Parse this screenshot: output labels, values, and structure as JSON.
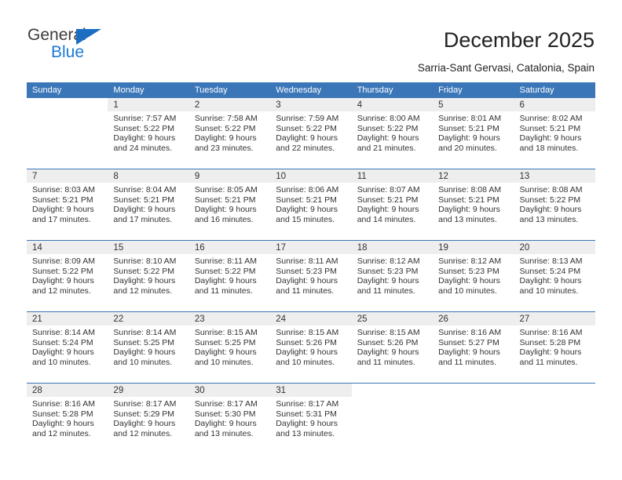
{
  "brand": {
    "name_top": "General",
    "name_bottom": "Blue",
    "triangle_color": "#1b6ec2",
    "blue_color": "#1b7ad6"
  },
  "header": {
    "title": "December 2025",
    "subtitle": "Sarria-Sant Gervasi, Catalonia, Spain",
    "accent_color": "#3a76b8"
  },
  "calendar": {
    "weekday_headers": [
      "Sunday",
      "Monday",
      "Tuesday",
      "Wednesday",
      "Thursday",
      "Friday",
      "Saturday"
    ],
    "weeks": [
      [
        {
          "day": "",
          "sunrise": "",
          "sunset": "",
          "daylight1": "",
          "daylight2": ""
        },
        {
          "day": "1",
          "sunrise": "Sunrise: 7:57 AM",
          "sunset": "Sunset: 5:22 PM",
          "daylight1": "Daylight: 9 hours",
          "daylight2": "and 24 minutes."
        },
        {
          "day": "2",
          "sunrise": "Sunrise: 7:58 AM",
          "sunset": "Sunset: 5:22 PM",
          "daylight1": "Daylight: 9 hours",
          "daylight2": "and 23 minutes."
        },
        {
          "day": "3",
          "sunrise": "Sunrise: 7:59 AM",
          "sunset": "Sunset: 5:22 PM",
          "daylight1": "Daylight: 9 hours",
          "daylight2": "and 22 minutes."
        },
        {
          "day": "4",
          "sunrise": "Sunrise: 8:00 AM",
          "sunset": "Sunset: 5:22 PM",
          "daylight1": "Daylight: 9 hours",
          "daylight2": "and 21 minutes."
        },
        {
          "day": "5",
          "sunrise": "Sunrise: 8:01 AM",
          "sunset": "Sunset: 5:21 PM",
          "daylight1": "Daylight: 9 hours",
          "daylight2": "and 20 minutes."
        },
        {
          "day": "6",
          "sunrise": "Sunrise: 8:02 AM",
          "sunset": "Sunset: 5:21 PM",
          "daylight1": "Daylight: 9 hours",
          "daylight2": "and 18 minutes."
        }
      ],
      [
        {
          "day": "7",
          "sunrise": "Sunrise: 8:03 AM",
          "sunset": "Sunset: 5:21 PM",
          "daylight1": "Daylight: 9 hours",
          "daylight2": "and 17 minutes."
        },
        {
          "day": "8",
          "sunrise": "Sunrise: 8:04 AM",
          "sunset": "Sunset: 5:21 PM",
          "daylight1": "Daylight: 9 hours",
          "daylight2": "and 17 minutes."
        },
        {
          "day": "9",
          "sunrise": "Sunrise: 8:05 AM",
          "sunset": "Sunset: 5:21 PM",
          "daylight1": "Daylight: 9 hours",
          "daylight2": "and 16 minutes."
        },
        {
          "day": "10",
          "sunrise": "Sunrise: 8:06 AM",
          "sunset": "Sunset: 5:21 PM",
          "daylight1": "Daylight: 9 hours",
          "daylight2": "and 15 minutes."
        },
        {
          "day": "11",
          "sunrise": "Sunrise: 8:07 AM",
          "sunset": "Sunset: 5:21 PM",
          "daylight1": "Daylight: 9 hours",
          "daylight2": "and 14 minutes."
        },
        {
          "day": "12",
          "sunrise": "Sunrise: 8:08 AM",
          "sunset": "Sunset: 5:21 PM",
          "daylight1": "Daylight: 9 hours",
          "daylight2": "and 13 minutes."
        },
        {
          "day": "13",
          "sunrise": "Sunrise: 8:08 AM",
          "sunset": "Sunset: 5:22 PM",
          "daylight1": "Daylight: 9 hours",
          "daylight2": "and 13 minutes."
        }
      ],
      [
        {
          "day": "14",
          "sunrise": "Sunrise: 8:09 AM",
          "sunset": "Sunset: 5:22 PM",
          "daylight1": "Daylight: 9 hours",
          "daylight2": "and 12 minutes."
        },
        {
          "day": "15",
          "sunrise": "Sunrise: 8:10 AM",
          "sunset": "Sunset: 5:22 PM",
          "daylight1": "Daylight: 9 hours",
          "daylight2": "and 12 minutes."
        },
        {
          "day": "16",
          "sunrise": "Sunrise: 8:11 AM",
          "sunset": "Sunset: 5:22 PM",
          "daylight1": "Daylight: 9 hours",
          "daylight2": "and 11 minutes."
        },
        {
          "day": "17",
          "sunrise": "Sunrise: 8:11 AM",
          "sunset": "Sunset: 5:23 PM",
          "daylight1": "Daylight: 9 hours",
          "daylight2": "and 11 minutes."
        },
        {
          "day": "18",
          "sunrise": "Sunrise: 8:12 AM",
          "sunset": "Sunset: 5:23 PM",
          "daylight1": "Daylight: 9 hours",
          "daylight2": "and 11 minutes."
        },
        {
          "day": "19",
          "sunrise": "Sunrise: 8:12 AM",
          "sunset": "Sunset: 5:23 PM",
          "daylight1": "Daylight: 9 hours",
          "daylight2": "and 10 minutes."
        },
        {
          "day": "20",
          "sunrise": "Sunrise: 8:13 AM",
          "sunset": "Sunset: 5:24 PM",
          "daylight1": "Daylight: 9 hours",
          "daylight2": "and 10 minutes."
        }
      ],
      [
        {
          "day": "21",
          "sunrise": "Sunrise: 8:14 AM",
          "sunset": "Sunset: 5:24 PM",
          "daylight1": "Daylight: 9 hours",
          "daylight2": "and 10 minutes."
        },
        {
          "day": "22",
          "sunrise": "Sunrise: 8:14 AM",
          "sunset": "Sunset: 5:25 PM",
          "daylight1": "Daylight: 9 hours",
          "daylight2": "and 10 minutes."
        },
        {
          "day": "23",
          "sunrise": "Sunrise: 8:15 AM",
          "sunset": "Sunset: 5:25 PM",
          "daylight1": "Daylight: 9 hours",
          "daylight2": "and 10 minutes."
        },
        {
          "day": "24",
          "sunrise": "Sunrise: 8:15 AM",
          "sunset": "Sunset: 5:26 PM",
          "daylight1": "Daylight: 9 hours",
          "daylight2": "and 10 minutes."
        },
        {
          "day": "25",
          "sunrise": "Sunrise: 8:15 AM",
          "sunset": "Sunset: 5:26 PM",
          "daylight1": "Daylight: 9 hours",
          "daylight2": "and 11 minutes."
        },
        {
          "day": "26",
          "sunrise": "Sunrise: 8:16 AM",
          "sunset": "Sunset: 5:27 PM",
          "daylight1": "Daylight: 9 hours",
          "daylight2": "and 11 minutes."
        },
        {
          "day": "27",
          "sunrise": "Sunrise: 8:16 AM",
          "sunset": "Sunset: 5:28 PM",
          "daylight1": "Daylight: 9 hours",
          "daylight2": "and 11 minutes."
        }
      ],
      [
        {
          "day": "28",
          "sunrise": "Sunrise: 8:16 AM",
          "sunset": "Sunset: 5:28 PM",
          "daylight1": "Daylight: 9 hours",
          "daylight2": "and 12 minutes."
        },
        {
          "day": "29",
          "sunrise": "Sunrise: 8:17 AM",
          "sunset": "Sunset: 5:29 PM",
          "daylight1": "Daylight: 9 hours",
          "daylight2": "and 12 minutes."
        },
        {
          "day": "30",
          "sunrise": "Sunrise: 8:17 AM",
          "sunset": "Sunset: 5:30 PM",
          "daylight1": "Daylight: 9 hours",
          "daylight2": "and 13 minutes."
        },
        {
          "day": "31",
          "sunrise": "Sunrise: 8:17 AM",
          "sunset": "Sunset: 5:31 PM",
          "daylight1": "Daylight: 9 hours",
          "daylight2": "and 13 minutes."
        },
        {
          "day": "",
          "sunrise": "",
          "sunset": "",
          "daylight1": "",
          "daylight2": ""
        },
        {
          "day": "",
          "sunrise": "",
          "sunset": "",
          "daylight1": "",
          "daylight2": ""
        },
        {
          "day": "",
          "sunrise": "",
          "sunset": "",
          "daylight1": "",
          "daylight2": ""
        }
      ]
    ]
  }
}
